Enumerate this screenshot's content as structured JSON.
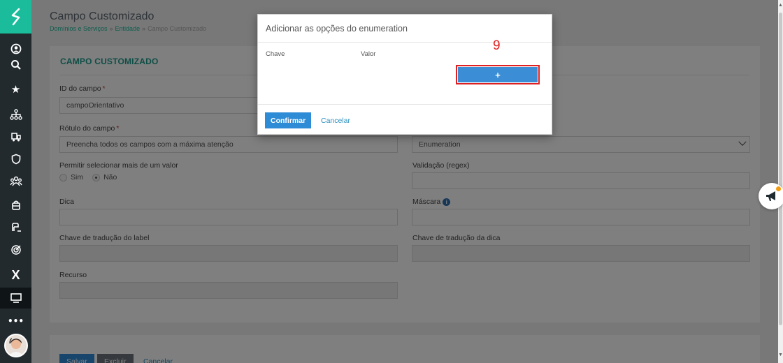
{
  "page": {
    "title": "Campo Customizado",
    "breadcrumb": [
      "Domínios e Serviços",
      "Entidade",
      "Campo Customizado"
    ],
    "breadcrumb_sep": "»"
  },
  "form": {
    "section_title": "CAMPO CUSTOMIZADO",
    "id_label": "ID do campo",
    "id_value": "campoOrientativo",
    "rotulo_label": "Rótulo do campo",
    "rotulo_value": "Preencha todos os campos com a máxima atenção",
    "tipo_value": "Enumeration",
    "multi_label": "Permitir selecionar mais de um valor",
    "multi_options": [
      "Sim",
      "Não"
    ],
    "multi_selected": "Não",
    "validacao_label": "Validação (regex)",
    "dica_label": "Dica",
    "mascara_label": "Máscara",
    "chave_label_label": "Chave de tradução do label",
    "chave_dica_label": "Chave de tradução da dica",
    "recurso_label": "Recurso",
    "required_mark": "*"
  },
  "actions": {
    "save": "Salvar",
    "delete": "Excluir",
    "cancel": "Cancelar"
  },
  "modal": {
    "title": "Adicionar as opções do enumeration",
    "col_key": "Chave",
    "col_value": "Valor",
    "add_label": "+",
    "confirm": "Confirmar",
    "cancel": "Cancelar"
  },
  "annotation": {
    "step": "9",
    "color": "#e02020"
  },
  "colors": {
    "accent": "#1abc9c",
    "primary": "#2e8bd6",
    "sidebar": "#222a2e"
  }
}
